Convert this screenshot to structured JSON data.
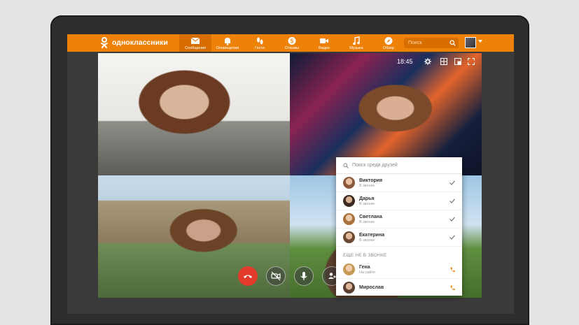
{
  "app": {
    "name": "одноклассники",
    "brand_color": "#ee8208"
  },
  "nav": [
    {
      "label": "Сообщения",
      "icon": "envelope-icon",
      "active": true
    },
    {
      "label": "Оповещения",
      "icon": "bell-icon",
      "active": false
    },
    {
      "label": "Гости",
      "icon": "footprints-icon",
      "active": false
    },
    {
      "label": "Отзывы",
      "icon": "rating-icon",
      "active": false
    },
    {
      "label": "Видео",
      "icon": "video-camera-icon",
      "active": false
    },
    {
      "label": "Музыка",
      "icon": "music-icon",
      "active": false
    },
    {
      "label": "Обзор",
      "icon": "compass-icon",
      "active": false
    }
  ],
  "search": {
    "placeholder": "Поиск"
  },
  "call": {
    "time": "18:45",
    "end_color": "#e23b2c"
  },
  "panel": {
    "search_placeholder": "Поиск среди друзей",
    "in_call": [
      {
        "name": "Виктория",
        "status": "В звонке"
      },
      {
        "name": "Дарья",
        "status": "В звонке"
      },
      {
        "name": "Светлана",
        "status": "В звонке"
      },
      {
        "name": "Екатерина",
        "status": "В звонке"
      }
    ],
    "not_in_call_title": "ЕЩЕ НЕ В ЗВОНКЕ",
    "not_in_call": [
      {
        "name": "Гена",
        "status": "На сайте"
      },
      {
        "name": "Мирослав",
        "status": ""
      }
    ]
  }
}
